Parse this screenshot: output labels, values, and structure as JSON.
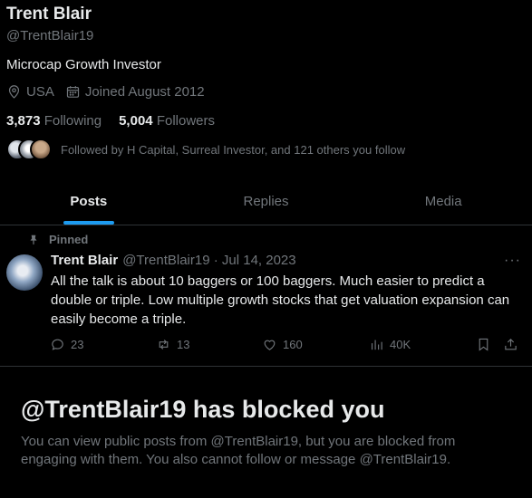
{
  "profile": {
    "name": "Trent Blair",
    "handle": "@TrentBlair19",
    "bio": "Microcap Growth Investor",
    "location": "USA",
    "joined": "Joined August 2012",
    "following_count": "3,873",
    "following_label": "Following",
    "followers_count": "5,004",
    "followers_label": "Followers",
    "followed_by": "Followed by H Capital, Surreal Investor, and 121 others you follow"
  },
  "tabs": [
    {
      "label": "Posts",
      "active": true
    },
    {
      "label": "Replies",
      "active": false
    },
    {
      "label": "Media",
      "active": false
    }
  ],
  "pinned_post": {
    "pinned_label": "Pinned",
    "author_name": "Trent Blair",
    "author_handle_date": "@TrentBlair19 · Jul 14, 2023",
    "more": "···",
    "text": "All the talk is about 10 baggers or 100 baggers. Much easier to predict a double or triple. Low multiple growth stocks that get valuation expansion can easily become a triple.",
    "replies": "23",
    "reposts": "13",
    "likes": "160",
    "views": "40K"
  },
  "blocked": {
    "title": "@TrentBlair19 has blocked you",
    "message": "You can view public posts from @TrentBlair19, but you are blocked from engaging with them. You also cannot follow or message @TrentBlair19."
  },
  "colors": {
    "background": "#000000",
    "primary_text": "#e7e9ea",
    "secondary_text": "#71767b",
    "accent": "#1d9bf0",
    "divider": "#2f3336"
  }
}
